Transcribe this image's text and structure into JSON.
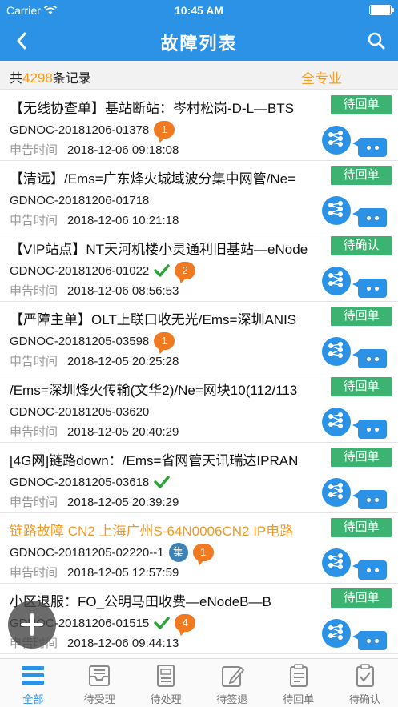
{
  "status_bar": {
    "carrier": "Carrier",
    "time": "10:45 AM",
    "battery": 1.0
  },
  "navbar": {
    "title": "故障列表"
  },
  "summary": {
    "prefix": "共",
    "count": "4298",
    "suffix": "条记录",
    "filter": "全专业"
  },
  "items": [
    {
      "title": "【无线协查单】基站断站：岑村松岗-D-L—BTS",
      "status": "待回单",
      "code": "GDNOC-20181206-01378",
      "time_label": "申告时间",
      "time": "2018-12-06 09:18:08",
      "badge": "1",
      "checked": false,
      "ji": "",
      "orange": false
    },
    {
      "title": "【清远】/Ems=广东烽火城域波分集中网管/Ne=",
      "status": "待回单",
      "code": "GDNOC-20181206-01718",
      "time_label": "申告时间",
      "time": "2018-12-06 10:21:18",
      "badge": "",
      "checked": false,
      "ji": "",
      "orange": false
    },
    {
      "title": "【VIP站点】NT天河机楼小灵通利旧基站—eNode",
      "status": "待确认",
      "code": "GDNOC-20181206-01022",
      "time_label": "申告时间",
      "time": "2018-12-06 08:56:53",
      "badge": "2",
      "checked": true,
      "ji": "",
      "orange": false
    },
    {
      "title": "【严障主单】OLT上联口收无光/Ems=深圳ANIS",
      "status": "待回单",
      "code": "GDNOC-20181205-03598",
      "time_label": "申告时间",
      "time": "2018-12-05 20:25:28",
      "badge": "1",
      "checked": false,
      "ji": "",
      "orange": false
    },
    {
      "title": "/Ems=深圳烽火传输(文华2)/Ne=网块10(112/113",
      "status": "待回单",
      "code": "GDNOC-20181205-03620",
      "time_label": "申告时间",
      "time": "2018-12-05 20:40:29",
      "badge": "",
      "checked": false,
      "ji": "",
      "orange": false
    },
    {
      "title": "[4G网]链路down：/Ems=省网管天讯瑞达IPRAN",
      "status": "待回单",
      "code": "GDNOC-20181205-03618",
      "time_label": "申告时间",
      "time": "2018-12-05 20:39:29",
      "badge": "",
      "checked": true,
      "ji": "",
      "orange": false
    },
    {
      "title": "链路故障 CN2 上海广州S-64N0006CN2 IP电路",
      "status": "待回单",
      "code": "GDNOC-20181205-02220--1",
      "time_label": "申告时间",
      "time": "2018-12-05 12:57:59",
      "badge": "1",
      "checked": false,
      "ji": "集",
      "orange": true
    },
    {
      "title": "小区退服：FO_公明马田收费—eNodeB—B",
      "status": "待回单",
      "code": "GDNOC-20181206-01515",
      "time_label": "申告时间",
      "time": "2018-12-06 09:44:13",
      "badge": "4",
      "checked": true,
      "ji": "",
      "orange": false
    }
  ],
  "tabs": [
    {
      "label": "全部",
      "icon": "all-list-icon",
      "active": true
    },
    {
      "label": "待受理",
      "icon": "inbox-icon",
      "active": false
    },
    {
      "label": "待处理",
      "icon": "document-icon",
      "active": false
    },
    {
      "label": "待签退",
      "icon": "pen-icon",
      "active": false
    },
    {
      "label": "待回单",
      "icon": "clipboard-icon",
      "active": false
    },
    {
      "label": "待确认",
      "icon": "check-clipboard-icon",
      "active": false
    }
  ],
  "colors": {
    "primary": "#2b92e6",
    "status_green": "#3cb371",
    "accent_orange": "#f39a1e",
    "badge_orange": "#f07a22"
  }
}
